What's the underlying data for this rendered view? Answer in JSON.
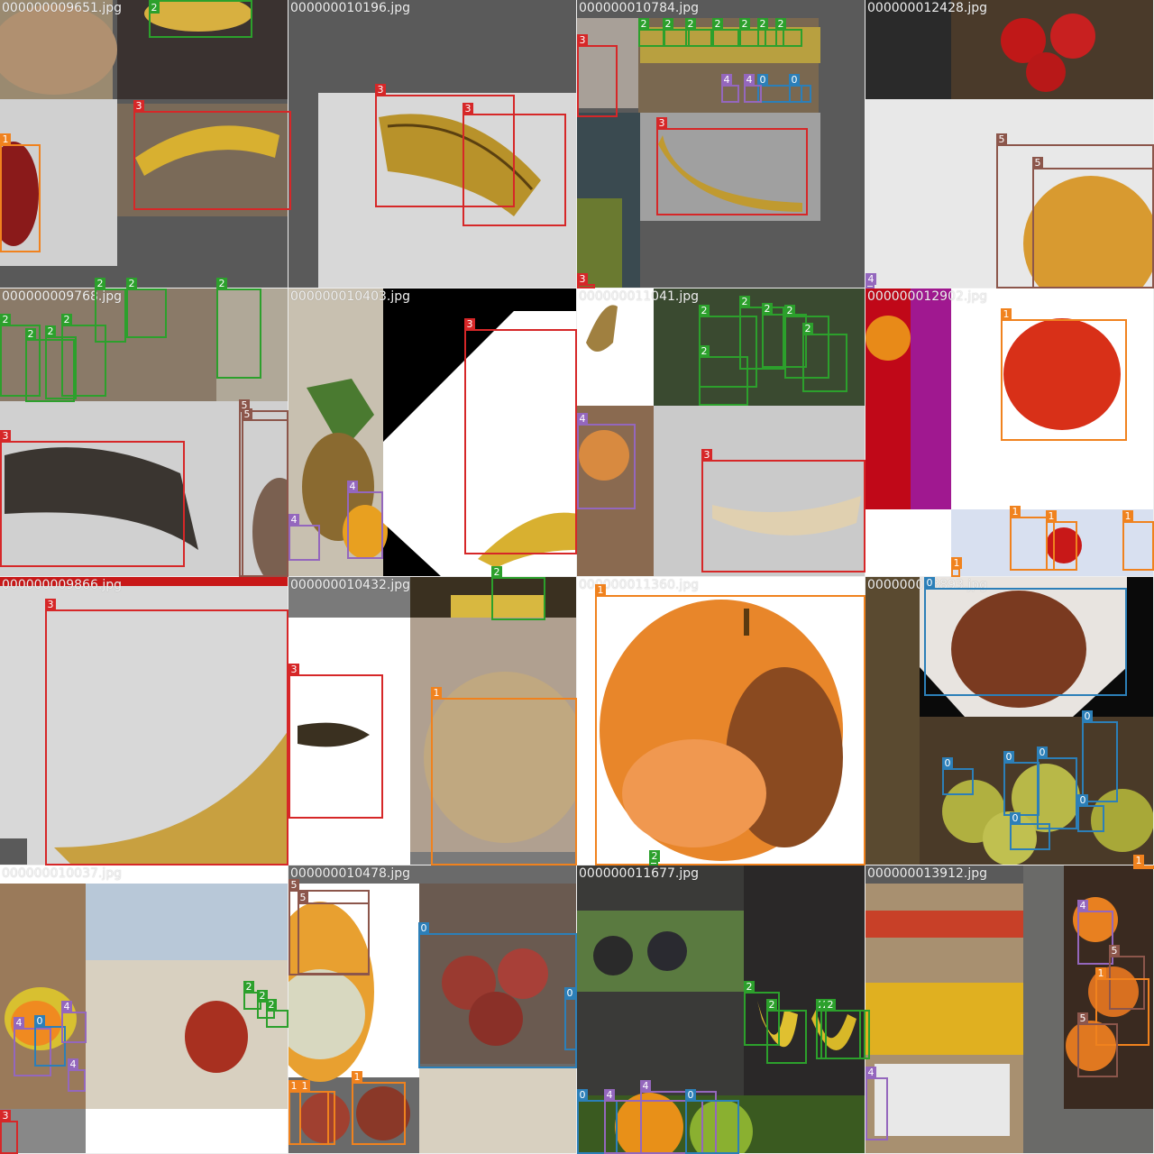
{
  "tiles": [
    {
      "filename": "000000009651.jpg",
      "boxes": [
        {
          "label": "1",
          "cls": 1
        },
        {
          "label": "3",
          "cls": 3
        },
        {
          "label": "2",
          "cls": 2
        }
      ]
    },
    {
      "filename": "000000010196.jpg",
      "boxes": [
        {
          "label": "3",
          "cls": 3
        },
        {
          "label": "3",
          "cls": 3
        }
      ]
    },
    {
      "filename": "000000010784.jpg",
      "boxes": [
        {
          "label": "3",
          "cls": 3
        },
        {
          "label": "3",
          "cls": 3
        },
        {
          "label": "2",
          "cls": 2
        },
        {
          "label": "2",
          "cls": 2
        },
        {
          "label": "2",
          "cls": 2
        },
        {
          "label": "2",
          "cls": 2
        },
        {
          "label": "2",
          "cls": 2
        },
        {
          "label": "2",
          "cls": 2
        },
        {
          "label": "2",
          "cls": 2
        },
        {
          "label": "0",
          "cls": 0
        },
        {
          "label": "0",
          "cls": 0
        },
        {
          "label": "4",
          "cls": 4
        },
        {
          "label": "4",
          "cls": 4
        },
        {
          "label": "3",
          "cls": 3
        }
      ]
    },
    {
      "filename": "000000012428.jpg",
      "boxes": [
        {
          "label": "5",
          "cls": 5
        },
        {
          "label": "5",
          "cls": 5
        },
        {
          "label": "4",
          "cls": 4
        }
      ]
    },
    {
      "filename": "000000009768.jpg",
      "boxes": [
        {
          "label": "2",
          "cls": 2
        },
        {
          "label": "2",
          "cls": 2
        },
        {
          "label": "2",
          "cls": 2
        },
        {
          "label": "2",
          "cls": 2
        },
        {
          "label": "2",
          "cls": 2
        },
        {
          "label": "2",
          "cls": 2
        },
        {
          "label": "2",
          "cls": 2
        },
        {
          "label": "3",
          "cls": 3
        },
        {
          "label": "5",
          "cls": 5
        },
        {
          "label": "5",
          "cls": 5
        }
      ]
    },
    {
      "filename": "000000010403.jpg",
      "boxes": [
        {
          "label": "3",
          "cls": 3
        },
        {
          "label": "4",
          "cls": 4
        },
        {
          "label": "4",
          "cls": 4
        }
      ]
    },
    {
      "filename": "000000011041.jpg",
      "boxes": [
        {
          "label": "2",
          "cls": 2
        },
        {
          "label": "2",
          "cls": 2
        },
        {
          "label": "2",
          "cls": 2
        },
        {
          "label": "2",
          "cls": 2
        },
        {
          "label": "2",
          "cls": 2
        },
        {
          "label": "2",
          "cls": 2
        },
        {
          "label": "4",
          "cls": 4
        },
        {
          "label": "3",
          "cls": 3
        }
      ]
    },
    {
      "filename": "000000012902.jpg",
      "boxes": [
        {
          "label": "1",
          "cls": 1
        },
        {
          "label": "1",
          "cls": 1
        },
        {
          "label": "1",
          "cls": 1
        },
        {
          "label": "1",
          "cls": 1
        },
        {
          "label": "1",
          "cls": 1
        }
      ]
    },
    {
      "filename": "000000009866.jpg",
      "boxes": [
        {
          "label": "3",
          "cls": 3
        }
      ]
    },
    {
      "filename": "000000010432.jpg",
      "boxes": [
        {
          "label": "2",
          "cls": 2
        },
        {
          "label": "3",
          "cls": 3
        },
        {
          "label": "1",
          "cls": 1
        }
      ]
    },
    {
      "filename": "000000011360.jpg",
      "boxes": [
        {
          "label": "1",
          "cls": 1
        },
        {
          "label": "2",
          "cls": 2
        }
      ]
    },
    {
      "filename": "000000013893.jpg",
      "boxes": [
        {
          "label": "0",
          "cls": 0
        },
        {
          "label": "0",
          "cls": 0
        },
        {
          "label": "0",
          "cls": 0
        },
        {
          "label": "0",
          "cls": 0
        },
        {
          "label": "0",
          "cls": 0
        },
        {
          "label": "0",
          "cls": 0
        },
        {
          "label": "0",
          "cls": 0
        },
        {
          "label": "1",
          "cls": 1
        }
      ]
    },
    {
      "filename": "000000010037.jpg",
      "boxes": [
        {
          "label": "4",
          "cls": 4
        },
        {
          "label": "0",
          "cls": 0
        },
        {
          "label": "4",
          "cls": 4
        },
        {
          "label": "4",
          "cls": 4
        },
        {
          "label": "2",
          "cls": 2
        },
        {
          "label": "2",
          "cls": 2
        },
        {
          "label": "2",
          "cls": 2
        },
        {
          "label": "3",
          "cls": 3
        }
      ]
    },
    {
      "filename": "000000010478.jpg",
      "boxes": [
        {
          "label": "5",
          "cls": 5
        },
        {
          "label": "5",
          "cls": 5
        },
        {
          "label": "0",
          "cls": 0
        },
        {
          "label": "0",
          "cls": 0
        },
        {
          "label": "1",
          "cls": 1
        },
        {
          "label": "1",
          "cls": 1
        },
        {
          "label": "1",
          "cls": 1
        }
      ]
    },
    {
      "filename": "000000011677.jpg",
      "boxes": [
        {
          "label": "2",
          "cls": 2
        },
        {
          "label": "2",
          "cls": 2
        },
        {
          "label": "2",
          "cls": 2
        },
        {
          "label": "2",
          "cls": 2
        },
        {
          "label": "2",
          "cls": 2
        },
        {
          "label": "2",
          "cls": 2
        },
        {
          "label": "0",
          "cls": 0
        },
        {
          "label": "4",
          "cls": 4
        },
        {
          "label": "4",
          "cls": 4
        },
        {
          "label": "0",
          "cls": 0
        }
      ]
    },
    {
      "filename": "000000013912.jpg",
      "boxes": [
        {
          "label": "4",
          "cls": 4
        },
        {
          "label": "5",
          "cls": 5
        },
        {
          "label": "1",
          "cls": 1
        },
        {
          "label": "5",
          "cls": 5
        },
        {
          "label": "4",
          "cls": 4
        }
      ]
    }
  ],
  "class_colors": {
    "0": "#2c7fb8",
    "1": "#f0821e",
    "2": "#2ca02c",
    "3": "#d62728",
    "4": "#9467bd",
    "5": "#8c564b"
  }
}
